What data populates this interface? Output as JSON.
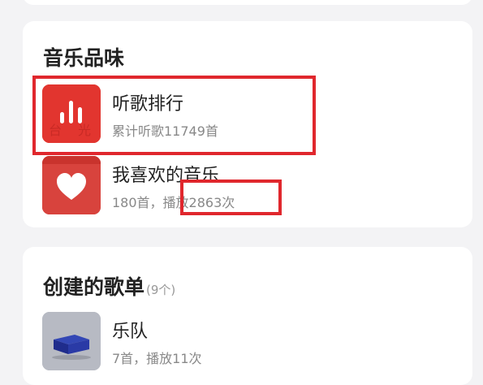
{
  "music_taste": {
    "title": "音乐品味",
    "items": [
      {
        "title": "听歌排行",
        "subtitle": "累计听歌11749首",
        "icon": "bar-chart-icon"
      },
      {
        "title": "我喜欢的音乐",
        "subtitle": "180首，播放2863次",
        "icon": "heart-icon"
      }
    ]
  },
  "playlists": {
    "title": "创建的歌单",
    "count": "(9个)",
    "items": [
      {
        "title": "乐队",
        "subtitle": "7首，播放11次",
        "icon": "blue-cube-cover"
      }
    ]
  },
  "colors": {
    "accent_red": "#e2352f",
    "highlight_red": "#e0272d",
    "background": "#f3f3f5"
  }
}
